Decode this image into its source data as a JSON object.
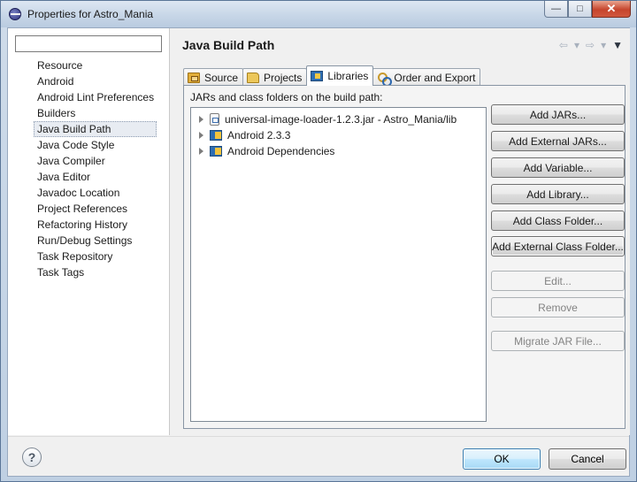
{
  "window": {
    "title": "Properties for Astro_Mania",
    "controls": {
      "minimize": "—",
      "maximize": "□",
      "close": "✕"
    }
  },
  "filter": {
    "value": "",
    "placeholder": ""
  },
  "nav": {
    "items": [
      {
        "label": "Resource",
        "selected": false
      },
      {
        "label": "Android",
        "selected": false
      },
      {
        "label": "Android Lint Preferences",
        "selected": false
      },
      {
        "label": "Builders",
        "selected": false
      },
      {
        "label": "Java Build Path",
        "selected": true
      },
      {
        "label": "Java Code Style",
        "selected": false
      },
      {
        "label": "Java Compiler",
        "selected": false
      },
      {
        "label": "Java Editor",
        "selected": false
      },
      {
        "label": "Javadoc Location",
        "selected": false
      },
      {
        "label": "Project References",
        "selected": false
      },
      {
        "label": "Refactoring History",
        "selected": false
      },
      {
        "label": "Run/Debug Settings",
        "selected": false
      },
      {
        "label": "Task Repository",
        "selected": false
      },
      {
        "label": "Task Tags",
        "selected": false
      }
    ]
  },
  "page": {
    "title": "Java Build Path",
    "nav_back": "⇦",
    "nav_back_menu": "▾",
    "nav_forward": "⇨",
    "nav_forward_menu": "▾",
    "view_menu": "▼"
  },
  "tabs": [
    {
      "label": "Source",
      "icon": "source-folder-icon",
      "active": false
    },
    {
      "label": "Projects",
      "icon": "projects-folder-icon",
      "active": false
    },
    {
      "label": "Libraries",
      "icon": "libraries-icon",
      "active": true
    },
    {
      "label": "Order and Export",
      "icon": "order-export-icon",
      "active": false
    }
  ],
  "libraries": {
    "label": "JARs and class folders on the build path:",
    "entries": [
      {
        "label": "universal-image-loader-1.2.3.jar - Astro_Mania/lib",
        "icon": "jar-icon"
      },
      {
        "label": "Android 2.3.3",
        "icon": "library-icon"
      },
      {
        "label": "Android Dependencies",
        "icon": "library-icon"
      }
    ],
    "buttons": [
      {
        "label": "Add JARs...",
        "enabled": true
      },
      {
        "label": "Add External JARs...",
        "enabled": true
      },
      {
        "label": "Add Variable...",
        "enabled": true
      },
      {
        "label": "Add Library...",
        "enabled": true
      },
      {
        "label": "Add Class Folder...",
        "enabled": true
      },
      {
        "label": "Add External Class Folder...",
        "enabled": true
      },
      {
        "label": "Edit...",
        "enabled": false
      },
      {
        "label": "Remove",
        "enabled": false
      },
      {
        "label": "Migrate JAR File...",
        "enabled": false
      }
    ]
  },
  "footer": {
    "help": "?",
    "ok_label": "OK",
    "cancel_label": "Cancel"
  },
  "colors": {
    "ok_accent": "#3c7fb1",
    "selection_bg": "#e8ecf2",
    "close_button": "#c6452d"
  }
}
